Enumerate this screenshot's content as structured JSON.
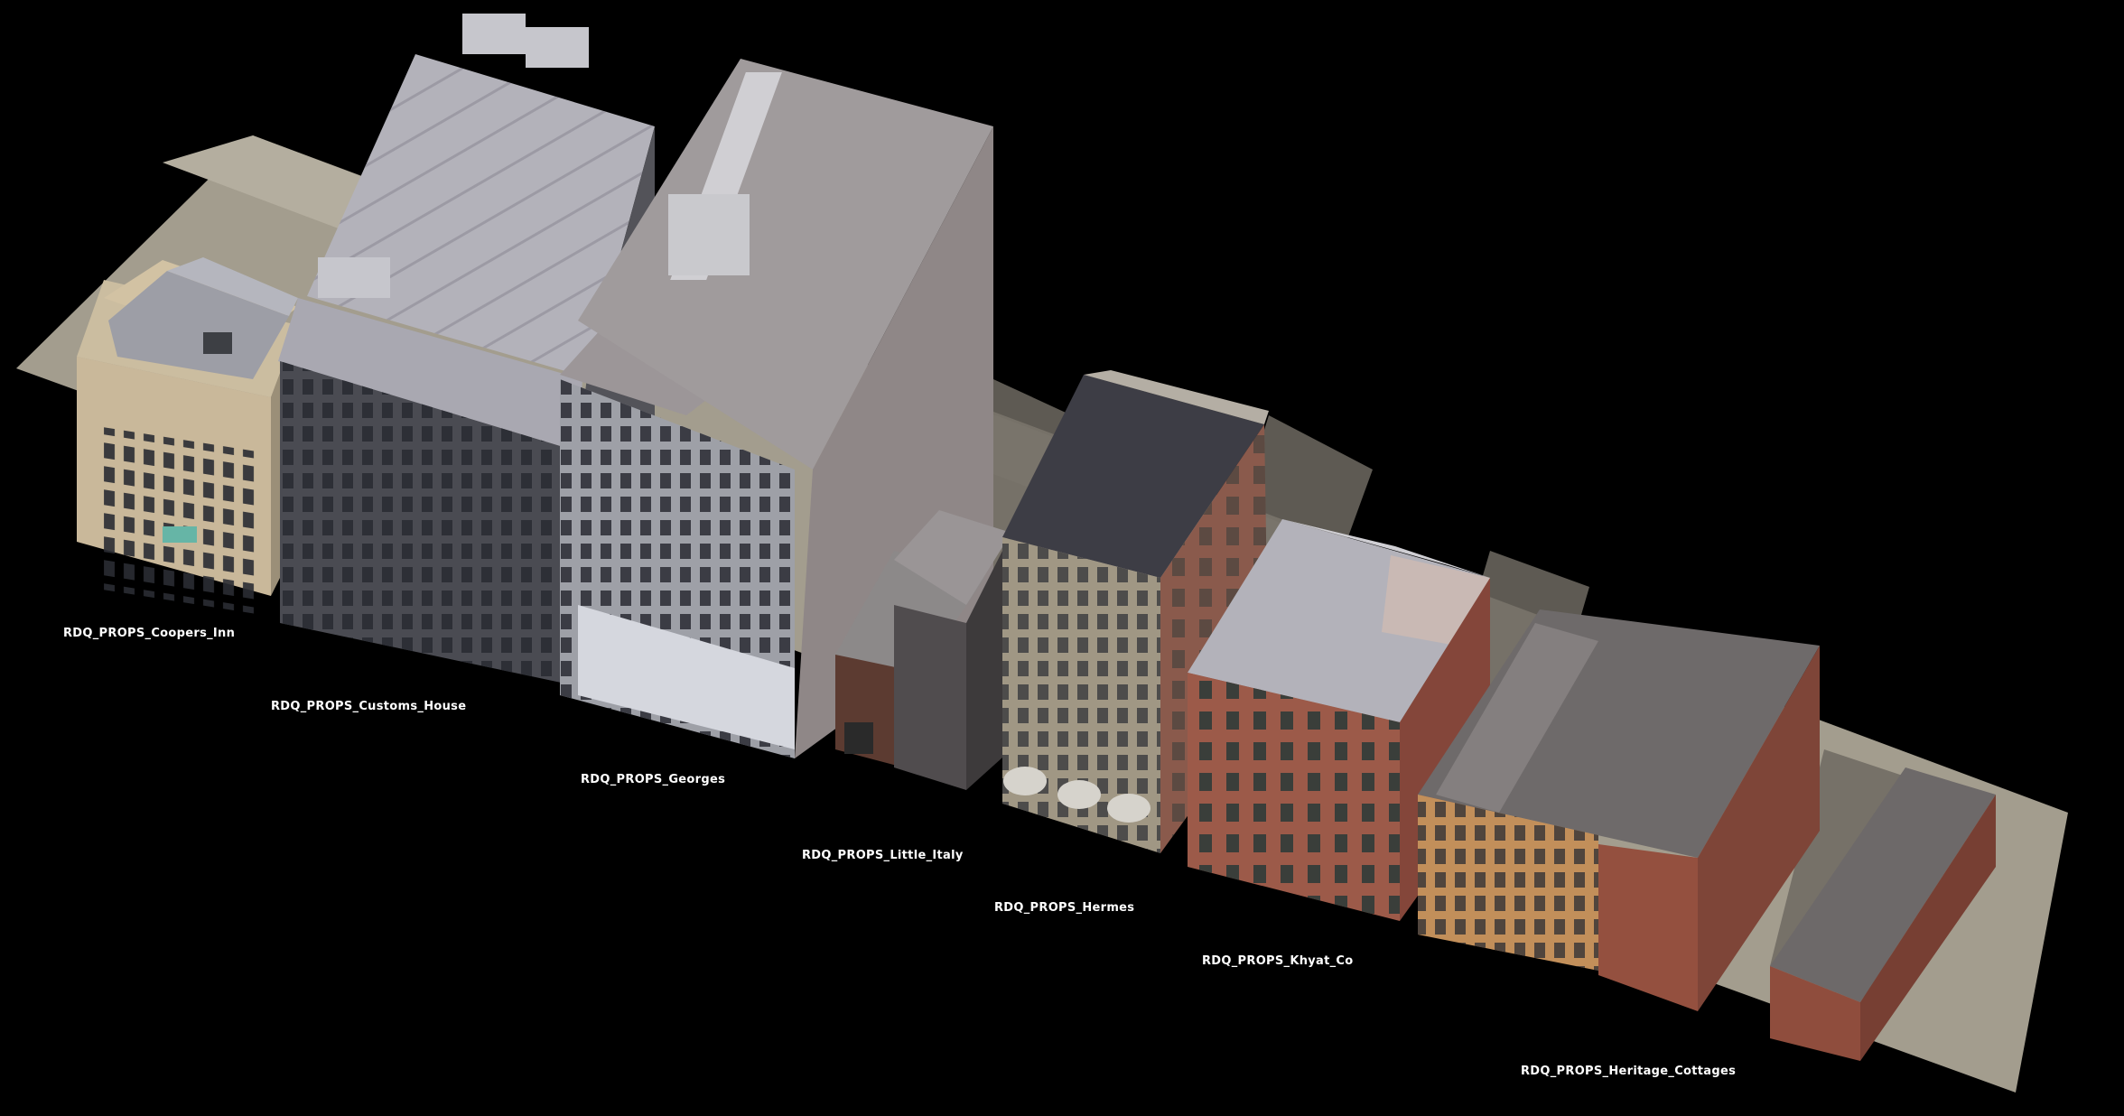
{
  "scene": {
    "background_color": "#000000",
    "label_color": "#ffffff",
    "ground_color": "#a39d8e",
    "shadow_color": "#5f5c56"
  },
  "props": [
    {
      "id": "coopers",
      "label": "RDQ_PROPS_Coopers_Inn"
    },
    {
      "id": "customs",
      "label": "RDQ_PROPS_Customs_House"
    },
    {
      "id": "georges",
      "label": "RDQ_PROPS_Georges"
    },
    {
      "id": "littleit",
      "label": "RDQ_PROPS_Little_Italy"
    },
    {
      "id": "hermes",
      "label": "RDQ_PROPS_Hermes"
    },
    {
      "id": "khyat",
      "label": "RDQ_PROPS_Khyat_Co"
    },
    {
      "id": "heritage",
      "label": "RDQ_PROPS_Heritage_Cottages"
    }
  ]
}
